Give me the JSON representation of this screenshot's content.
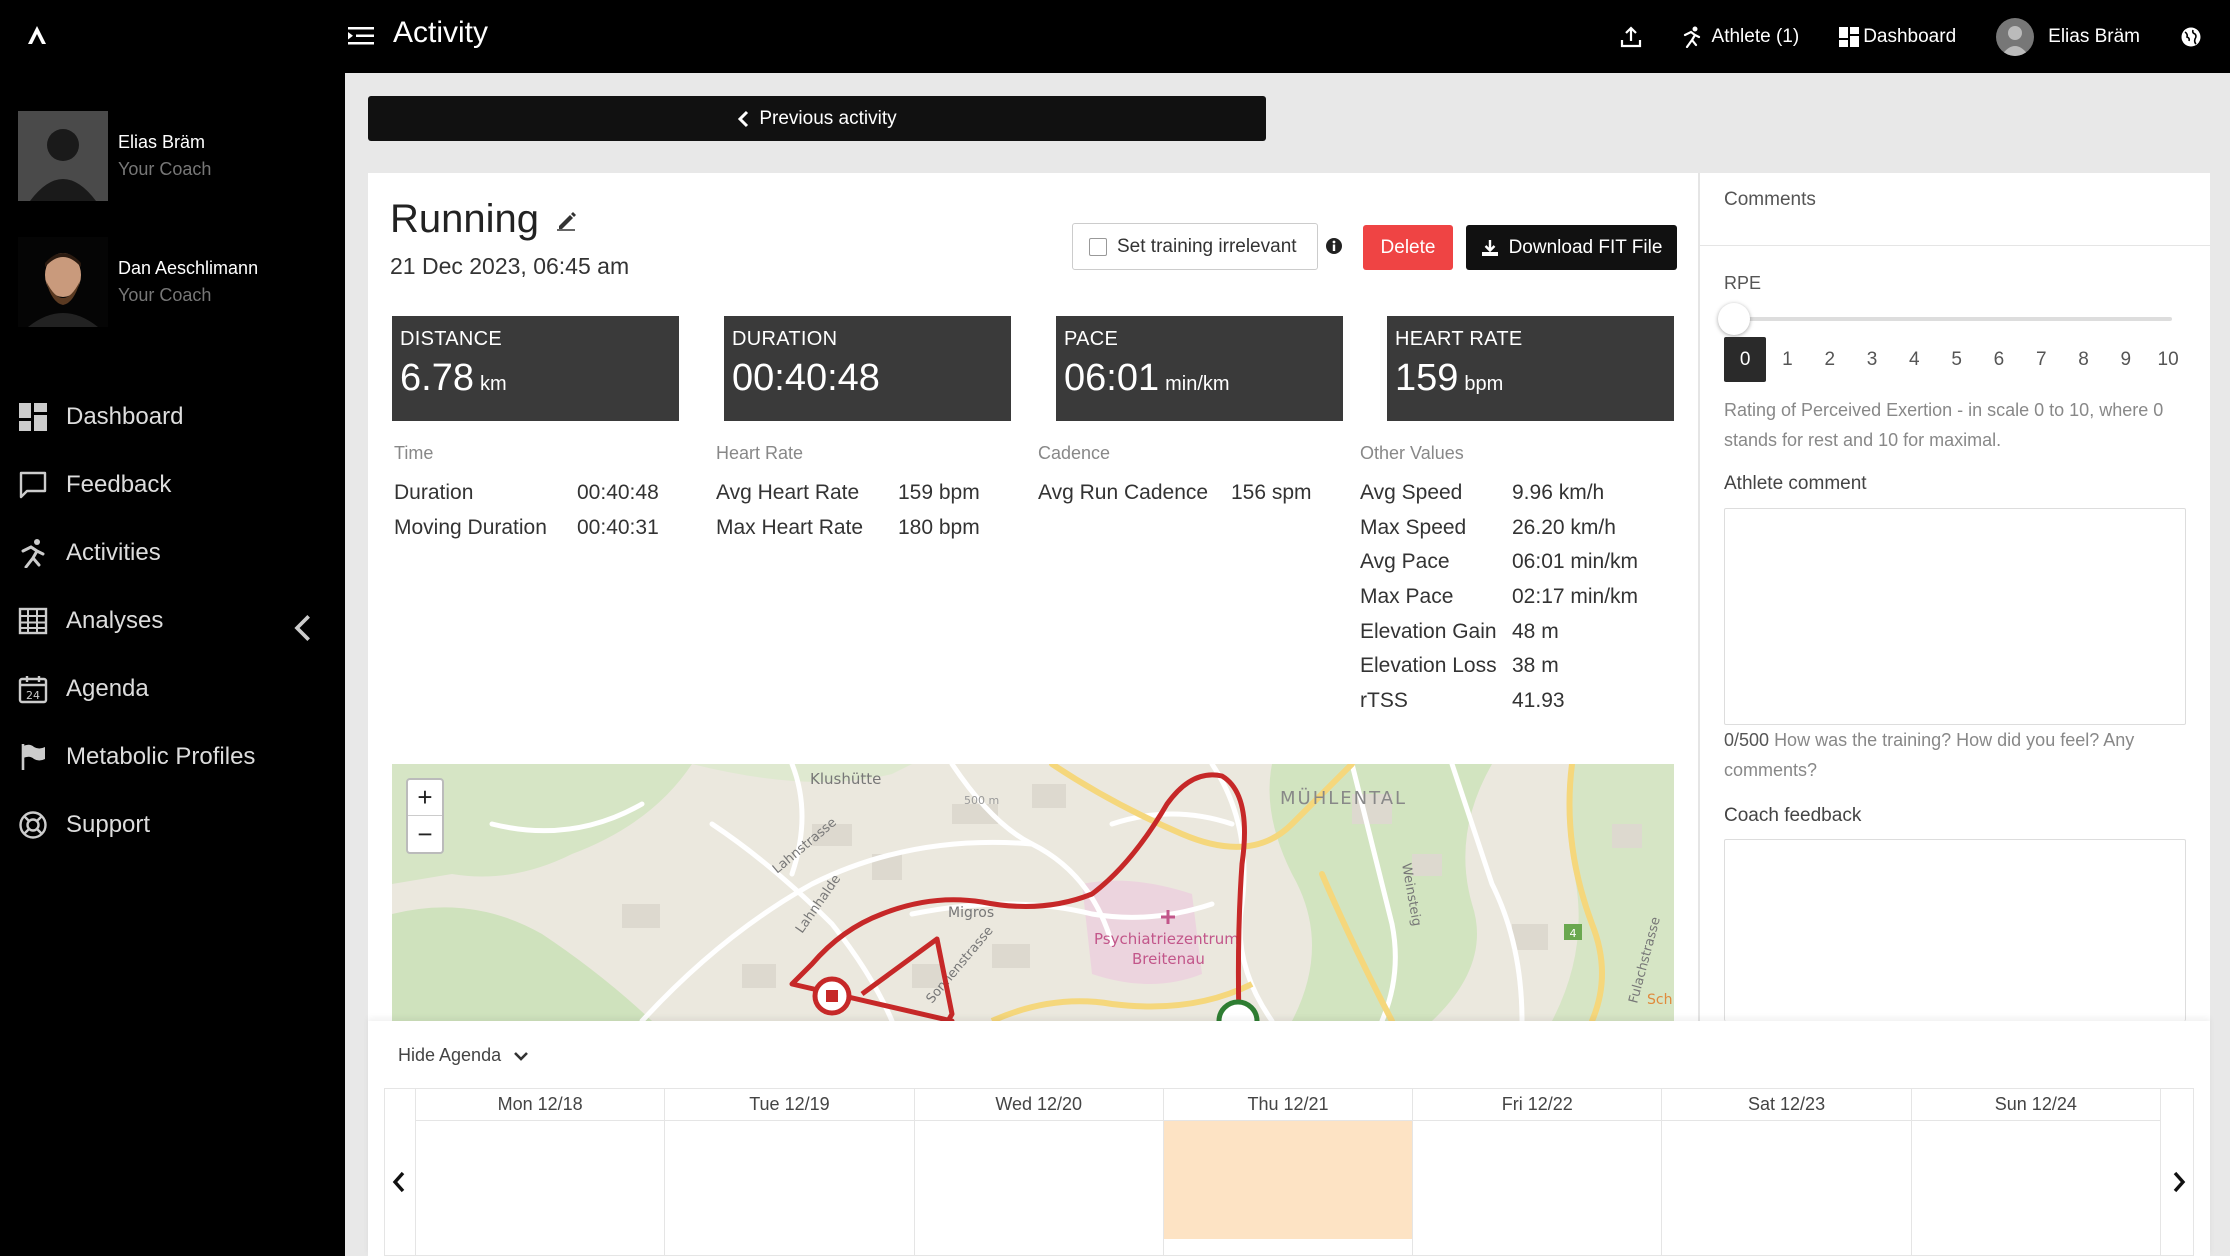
{
  "app": {
    "title": "Activity"
  },
  "topbar": {
    "athlete_label": "Athlete (1)",
    "dashboard_label": "Dashboard",
    "user_name": "Elias Bräm"
  },
  "sidebar": {
    "coaches": [
      {
        "name": "Elias Bräm",
        "role": "Your Coach"
      },
      {
        "name": "Dan Aeschlimann",
        "role": "Your Coach"
      }
    ],
    "nav": [
      {
        "label": "Dashboard",
        "icon": "dashboard-icon"
      },
      {
        "label": "Feedback",
        "icon": "feedback-icon"
      },
      {
        "label": "Activities",
        "icon": "running-icon"
      },
      {
        "label": "Analyses",
        "icon": "table-icon"
      },
      {
        "label": "Agenda",
        "icon": "calendar-icon"
      },
      {
        "label": "Metabolic Profiles",
        "icon": "flag-icon"
      },
      {
        "label": "Support",
        "icon": "lifebuoy-icon"
      }
    ]
  },
  "nav_prev": {
    "label": "Previous activity"
  },
  "activity": {
    "title": "Running",
    "date": "21 Dec 2023, 06:45 am",
    "irrelevant_label": "Set training irrelevant",
    "delete_label": "Delete",
    "download_label": "Download FIT File"
  },
  "stats": [
    {
      "label": "DISTANCE",
      "value": "6.78",
      "unit": "km"
    },
    {
      "label": "DURATION",
      "value": "00:40:48",
      "unit": ""
    },
    {
      "label": "PACE",
      "value": "06:01",
      "unit": "min/km"
    },
    {
      "label": "HEART RATE",
      "value": "159",
      "unit": "bpm"
    }
  ],
  "details": {
    "time": {
      "heading": "Time",
      "rows": [
        {
          "k": "Duration",
          "v": "00:40:48"
        },
        {
          "k": "Moving Duration",
          "v": "00:40:31"
        }
      ]
    },
    "heart": {
      "heading": "Heart Rate",
      "rows": [
        {
          "k": "Avg Heart Rate",
          "v": "159 bpm"
        },
        {
          "k": "Max Heart Rate",
          "v": "180 bpm"
        }
      ]
    },
    "cadence": {
      "heading": "Cadence",
      "rows": [
        {
          "k": "Avg Run Cadence",
          "v": "156 spm"
        }
      ]
    },
    "other": {
      "heading": "Other Values",
      "rows": [
        {
          "k": "Avg Speed",
          "v": "9.96 km/h"
        },
        {
          "k": "Max Speed",
          "v": "26.20 km/h"
        },
        {
          "k": "Avg Pace",
          "v": "06:01 min/km"
        },
        {
          "k": "Max Pace",
          "v": "02:17 min/km"
        },
        {
          "k": "Elevation Gain",
          "v": "48 m"
        },
        {
          "k": "Elevation Loss",
          "v": "38 m"
        },
        {
          "k": "rTSS",
          "v": "41.93"
        }
      ]
    }
  },
  "map": {
    "labels": {
      "klushutte": "Klushütte",
      "muhlental": "MÜHLENTAL",
      "lahnstrasse": "Lahnstrasse",
      "lahnhalde": "Lahnhalde",
      "migros": "Migros",
      "sonnenstrasse": "Sonnenstrasse",
      "psych1": "Psychiatriezentrum",
      "psych2": "Breitenau",
      "weinsteig": "Weinsteig",
      "fulachstrasse": "Fulachstrasse",
      "elev": "500 m",
      "route_num": "4",
      "sch": "Sch"
    },
    "zoom_in": "+",
    "zoom_out": "−"
  },
  "comments": {
    "title": "Comments",
    "rpe_label": "RPE",
    "rpe_values": [
      "0",
      "1",
      "2",
      "3",
      "4",
      "5",
      "6",
      "7",
      "8",
      "9",
      "10"
    ],
    "rpe_selected": 0,
    "rpe_desc": "Rating of Perceived Exertion - in scale 0 to 10, where 0 stands for rest and 10 for maximal.",
    "athlete_comment_label": "Athlete comment",
    "char_count": "0/500",
    "hint": "How was the training? How did you feel? Any comments?",
    "coach_feedback_label": "Coach feedback"
  },
  "agenda": {
    "toggle_label": "Hide Agenda",
    "days": [
      {
        "label": "Mon 12/18",
        "today": false
      },
      {
        "label": "Tue 12/19",
        "today": false
      },
      {
        "label": "Wed 12/20",
        "today": false
      },
      {
        "label": "Thu 12/21",
        "today": true
      },
      {
        "label": "Fri 12/22",
        "today": false
      },
      {
        "label": "Sat 12/23",
        "today": false
      },
      {
        "label": "Sun 12/24",
        "today": false
      }
    ]
  },
  "colors": {
    "accent_dark": "#111111",
    "delete_red": "#ef4444",
    "route_red": "#c62828",
    "today_highlight": "#fde3c4"
  }
}
